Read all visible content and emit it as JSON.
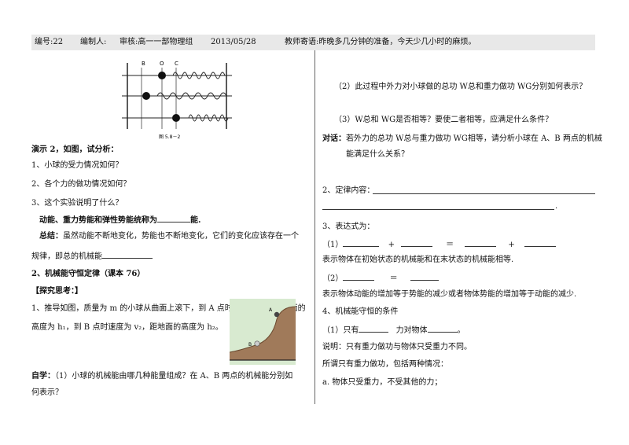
{
  "header": {
    "number": "编号:22",
    "author": "编制人:",
    "reviewer": "审核:高一一部物理组",
    "date": "2013/05/28",
    "motto": "教师寄语:昨晚多几分钟的准备，今天少几小时的麻烦。"
  },
  "figure1": {
    "labels": [
      "B",
      "O",
      "C"
    ],
    "caption": "图 5.8－2"
  },
  "left": {
    "demo_title": "演示 2，如图，试分析：",
    "q1": "1、小球的受力情况如何？",
    "q2": "2、各个力的做功情况如何？",
    "q3": "3、这个实验说明了什么？",
    "sum_prefix": "动能、重力势能和弹性势能统称为",
    "sum_suffix": "能.",
    "conclusion_label": "总结：",
    "conclusion_text": "虽然动能不断地变化，势能也不断地变化，它们的变化应该存在一个",
    "conclusion_line2": "规律，即总的机械能",
    "section2": "2、机械能守恒定律（课本 76）",
    "explore": "【探究思考：】",
    "derive1": "1、推导如图，质量为 m 的小球从曲面上滚下，到 A 点时速度为 v₁，距地面的",
    "derive2": "高度为 h₁，到 B 点时速度为 v₂，距地面的高度为 h₂。",
    "self_label": "自学：",
    "self1": "（1）小球的机械能由哪几种能量组成？在 A、B 两点的机械能分别如",
    "self2": "何表示？"
  },
  "figure2": {
    "labels": [
      "A",
      "B"
    ]
  },
  "right": {
    "r1": "（2）此过程中外力对小球做的总功 W总和重力做功 WG分别如何表示？",
    "r2": "（3）W总和 WG是否相等？要使二者相等，应满足什么条件？",
    "dialog_label": "对话：",
    "dialog1": "若外力的总功 W总与重力做功 WG相等，请分析小球在 A、B 两点的机械",
    "dialog2": "能满足什么关系？",
    "law": "2、定律内容：",
    "expr": "3、表达式为：",
    "e1_prefix": "（1）",
    "plus": "+",
    "eq": "＝",
    "e1_desc": "表示物体在初始状态的机械能和在末状态的机械能相等.",
    "e2_prefix": "（2）",
    "e2_desc": "表示物体动能的增加等于势能的减少或者物体势能的增加等于动能的减少.",
    "cond": "4、机械能守恒的条件",
    "c1_a": "（1）只有",
    "c1_b": "力对物体",
    "c1_c": "。",
    "explain": "说明：只有重力做功与物体只受重力不同。",
    "cases": "所谓只有重力做功，包括两种情况：",
    "case_a": "a. 物体只受重力，不受其他的力；"
  }
}
